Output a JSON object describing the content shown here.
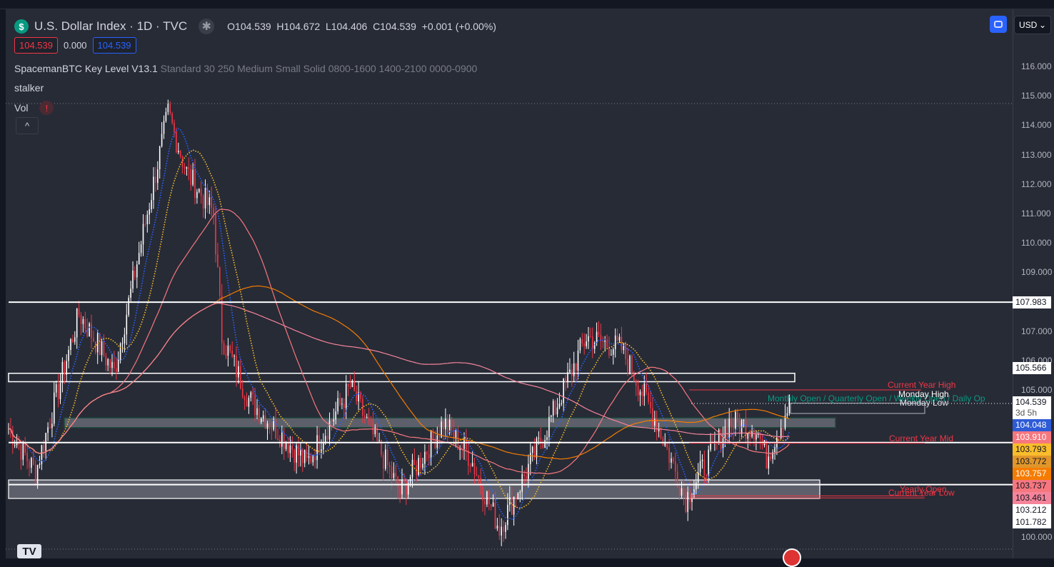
{
  "header": {
    "symbol_icon": "$",
    "title": "U.S. Dollar Index · 1D · TVC",
    "open_label": "O",
    "open": "104.539",
    "high_label": "H",
    "high": "104.672",
    "low_label": "L",
    "low": "104.406",
    "close_label": "C",
    "close": "104.539",
    "change": "+0.001 (+0.00%)",
    "bid": "104.539",
    "spread": "0.000",
    "ask": "104.539"
  },
  "indicators": {
    "key_level_name": "SpacemanBTC Key Level V13.1",
    "key_level_params": "Standard 30 250 Medium Small Solid 0800-1600 1400-2100 0000-0900",
    "stalker": "stalker",
    "vol": "Vol",
    "vol_warning": "!",
    "collapse": "^"
  },
  "axis": {
    "currency": "USD",
    "ticks": [
      "116.000",
      "115.000",
      "114.000",
      "113.000",
      "112.000",
      "111.000",
      "110.000",
      "109.000",
      "107.000",
      "106.000",
      "105.000",
      "100.000"
    ],
    "labels": [
      {
        "text": "107.983",
        "bg": "#ffffff",
        "fg": "#131722",
        "price": 107.983
      },
      {
        "text": "105.566",
        "bg": "#ffffff",
        "fg": "#131722",
        "price": 105.566
      },
      {
        "text": "104.539",
        "sub": "3d 5h",
        "bg": "#ffffff",
        "fg": "#131722",
        "price": 104.539
      },
      {
        "text": "104.048",
        "bg": "#2e5bd6",
        "fg": "#ffffff",
        "price": 104.048
      },
      {
        "text": "103.910",
        "bg": "#f7777f",
        "fg": "#ffffff",
        "price": 103.91
      },
      {
        "text": "103.793",
        "bg": "#f9bd2c",
        "fg": "#131722",
        "price": 103.793
      },
      {
        "text": "103.772",
        "bg": "#e0962a",
        "fg": "#131722",
        "price": 103.772
      },
      {
        "text": "103.757",
        "bg": "#f57c00",
        "fg": "#ffffff",
        "price": 103.757
      },
      {
        "text": "103.737",
        "bg": "#f7777f",
        "fg": "#131722",
        "price": 103.737
      },
      {
        "text": "103.461",
        "bg": "#f5849a",
        "fg": "#131722",
        "price": 103.461
      },
      {
        "text": "103.212",
        "bg": "#ffffff",
        "fg": "#131722",
        "price": 103.212
      },
      {
        "text": "101.782",
        "bg": "#ffffff",
        "fg": "#131722",
        "price": 101.782
      }
    ]
  },
  "levels": {
    "current_year_high": "Current Year High",
    "current_year_mid": "Current Year Mid",
    "current_year_low": "Current Year Low",
    "yearly_open": "Yearly Open",
    "monday_high": "Monday High",
    "monday_low": "Monday Low",
    "opens": "Monthly Open / Quarterly Open / Weekly Open / Daily Op"
  },
  "chart_data": {
    "type": "candlestick",
    "ylim": [
      99.5,
      117
    ],
    "up_color": "#ffffff",
    "down_color": "#f23645",
    "waypoints": [
      [
        0,
        103.7
      ],
      [
        13,
        102.2
      ],
      [
        34,
        107.6
      ],
      [
        51,
        105.6
      ],
      [
        77,
        114.4
      ],
      [
        86,
        112.4
      ],
      [
        99,
        111
      ],
      [
        103,
        106.8
      ],
      [
        116,
        104.7
      ],
      [
        144,
        102.5
      ],
      [
        165,
        105.1
      ],
      [
        189,
        101.5
      ],
      [
        210,
        103.9
      ],
      [
        223,
        102.7
      ],
      [
        237,
        100.3
      ],
      [
        258,
        103.4
      ],
      [
        279,
        106.8
      ],
      [
        296,
        106.4
      ],
      [
        313,
        103.9
      ],
      [
        327,
        101.3
      ],
      [
        348,
        103.9
      ],
      [
        361,
        103.7
      ],
      [
        366,
        102.7
      ],
      [
        377,
        104.54
      ]
    ],
    "ma_periods": [
      10,
      20,
      50,
      100,
      200
    ],
    "ma_colors": [
      "#2962ff",
      "#f9bd2c",
      "#f7777f",
      "#f57c00",
      "#f5849a"
    ]
  }
}
